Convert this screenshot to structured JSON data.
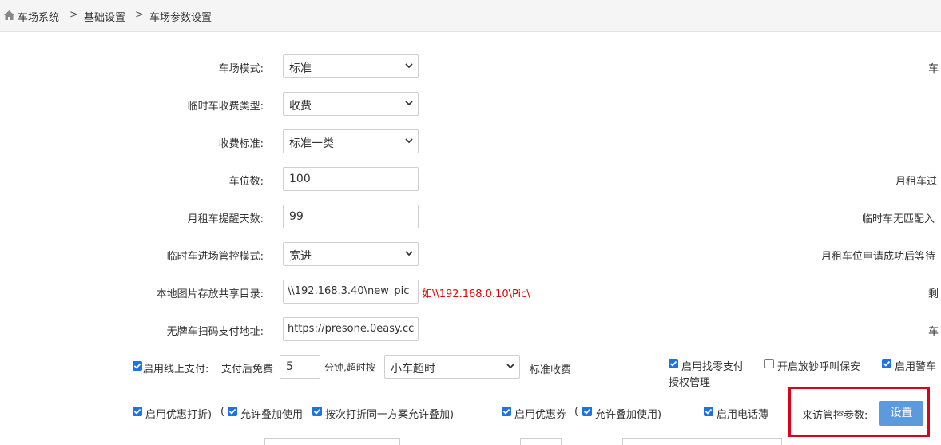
{
  "breadcrumb": {
    "home": "车场系统",
    "sep": ">",
    "level2": "基础设置",
    "level3": "车场参数设置"
  },
  "form": {
    "park_mode": {
      "label": "车场模式:",
      "value": "标准"
    },
    "temp_fee_type": {
      "label": "临时车收费类型:",
      "value": "收费"
    },
    "fee_standard": {
      "label": "收费标准:",
      "value": "标准一类"
    },
    "space_count": {
      "label": "车位数:",
      "value": "100"
    },
    "monthly_remind_days": {
      "label": "月租车提醒天数:",
      "value": "99"
    },
    "temp_entry_mode": {
      "label": "临时车进场管控模式:",
      "value": "宽进"
    },
    "image_share_dir": {
      "label": "本地图片存放共享目录:",
      "value": "\\\\192.168.3.40\\new_pic",
      "hint": "如\\\\192.168.0.10\\Pic\\"
    },
    "plateless_pay_url": {
      "label": "无牌车扫码支付地址:",
      "value": "https://presone.0easy.cc"
    }
  },
  "right_column": [
    "车",
    "月租车过",
    "临时车无匹配入",
    "月租车位申请成功后等待",
    "剩",
    "车"
  ],
  "online_pay": {
    "label": "启用线上支付:",
    "free_prefix": "支付后免费",
    "free_minutes": "5",
    "minute_suffix": "分钟,超时按",
    "overtime_mode": "小车超时",
    "standard_fee": "标准收费"
  },
  "options": {
    "change_pay": "启用找零支付",
    "auth_manage": "授权管理",
    "cash_call": "开启放钞呼叫保安",
    "police_car": "启用警车",
    "discount": "启用优惠打折)",
    "open_paren": "(",
    "allow_stack": "允许叠加使用",
    "allow_stack_same": "按次打折同一方案允许叠加)",
    "coupon": "启用优惠券",
    "coupon_open": "(",
    "coupon_stack": "允许叠加使用)",
    "phonebook": "启用电话薄"
  },
  "visitor": {
    "label": "来访管控参数:",
    "button": "设置"
  }
}
